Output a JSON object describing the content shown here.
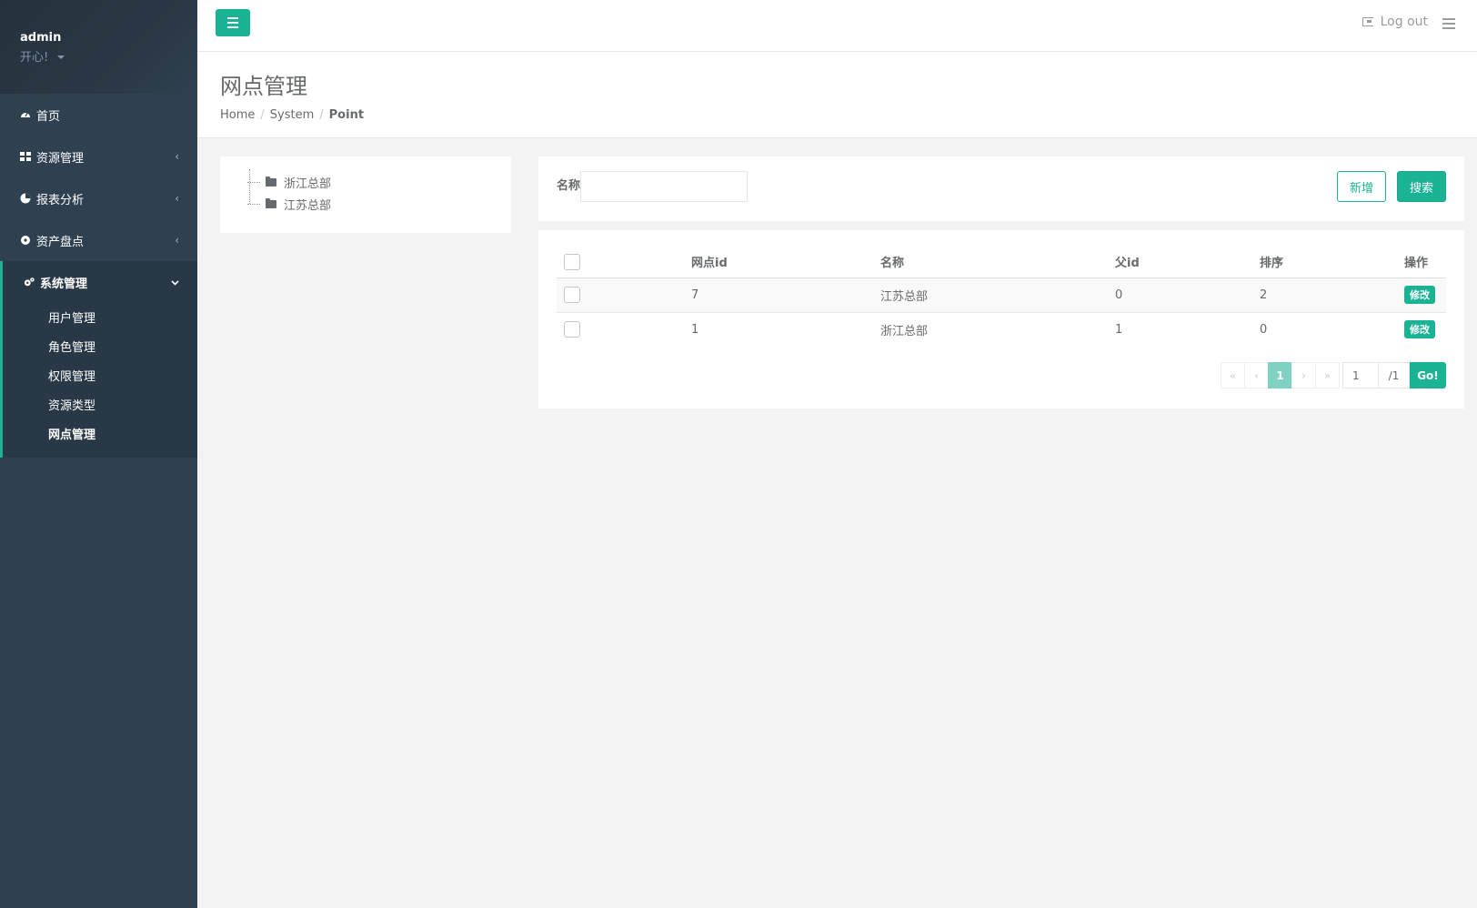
{
  "profile": {
    "name": "admin",
    "status": "开心!"
  },
  "sidebar": {
    "items": [
      {
        "label": "首页",
        "icon": "dashboard-icon"
      },
      {
        "label": "资源管理",
        "icon": "grid-icon"
      },
      {
        "label": "报表分析",
        "icon": "pie-chart-icon"
      },
      {
        "label": "资产盘点",
        "icon": "gear-icon"
      },
      {
        "label": "系统管理",
        "icon": "gears-icon"
      }
    ],
    "subitems": [
      "用户管理",
      "角色管理",
      "权限管理",
      "资源类型",
      "网点管理"
    ]
  },
  "topbar": {
    "logout_label": "Log out"
  },
  "page": {
    "title": "网点管理"
  },
  "breadcrumb": {
    "home": "Home",
    "system": "System",
    "current": "Point"
  },
  "tree": {
    "nodes": [
      "浙江总部",
      "江苏总部"
    ]
  },
  "search": {
    "label": "名称",
    "value": "",
    "add_label": "新增",
    "search_label": "搜索"
  },
  "table": {
    "headers": [
      "网点id",
      "名称",
      "父id",
      "排序",
      "操作"
    ],
    "rows": [
      {
        "id": "7",
        "name": "江苏总部",
        "parent_id": "0",
        "order": "2",
        "action": "修改"
      },
      {
        "id": "1",
        "name": "浙江总部",
        "parent_id": "1",
        "order": "0",
        "action": "修改"
      }
    ]
  },
  "pagination": {
    "first": "«",
    "prev": "‹",
    "current": "1",
    "next": "›",
    "last": "»",
    "page_input": "1",
    "total": "/1",
    "go_label": "Go!"
  },
  "colors": {
    "sidebar_bg": "#2f4050",
    "accent": "#1ab394",
    "page_bg": "#f3f3f4"
  }
}
